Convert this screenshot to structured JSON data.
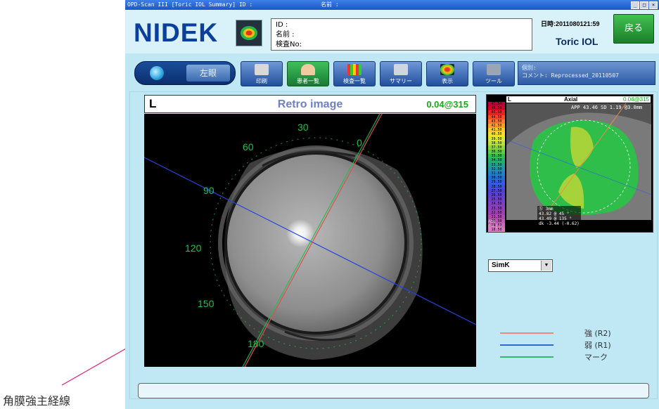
{
  "annotation": {
    "label": "角膜強主経線"
  },
  "window": {
    "title": "OPD-Scan III [Toric IOL Summary] ID :",
    "name_label": "名前 :"
  },
  "header": {
    "brand": "NIDEK",
    "patient": {
      "id_label": "ID :",
      "name_label": "名前 :",
      "exam_label": "検査No:"
    },
    "datetime": "日時:2011080121:59",
    "mode": "Toric IOL",
    "back_label": "戻る"
  },
  "toolbar": {
    "eye_label": "左眼",
    "buttons": [
      {
        "label": "印刷"
      },
      {
        "label": "患者一覧"
      },
      {
        "label": "検査一覧"
      },
      {
        "label": "サマリー"
      },
      {
        "label": "表示"
      },
      {
        "label": "ツール"
      }
    ],
    "comment_line1": "個別:",
    "comment_line2": "コメント: Reprocessed_20110507"
  },
  "retro": {
    "eye": "L",
    "title": "Retro image",
    "axis_value": "0.04@315",
    "angle_labels": [
      "30",
      "0",
      "60",
      "90",
      "120",
      "150",
      "180"
    ]
  },
  "axial": {
    "eye": "L",
    "map_name": "Axial",
    "value": "0.04@315",
    "app_line": "APP 43.46 SD 1.19  @3.0mm",
    "scale": [
      "47.50",
      "46.50",
      "45.50",
      "44.50",
      "43.50",
      "42.50",
      "41.50",
      "40.50",
      "39.50",
      "38.50",
      "37.50",
      "36.50",
      "35.50",
      "34.50",
      "33.50",
      "32.50",
      "31.50",
      "30.50",
      "29.50",
      "28.50",
      "27.50",
      "26.50",
      "25.50",
      "24.50",
      "23.50",
      "22.50",
      "21.50",
      "20.50",
      "19.50",
      "18.50"
    ],
    "simk_line1": "Ⓢ 3mm",
    "simk_line2": "43.82 @ 45 °",
    "simk_line3": "43.49 @ 135 °",
    "simk_line4": "dk -3.44 (-0.62)",
    "abs_line1": "Abs",
    "abs_line2": "0.4-1.0"
  },
  "select": {
    "value": "SimK"
  },
  "legend": [
    {
      "label": "強 (R2)",
      "color": "#f08878"
    },
    {
      "label": "弱 (R1)",
      "color": "#2d6cc4"
    },
    {
      "label": "マーク",
      "color": "#36b86a"
    }
  ],
  "status_bar": {
    "text": ""
  }
}
